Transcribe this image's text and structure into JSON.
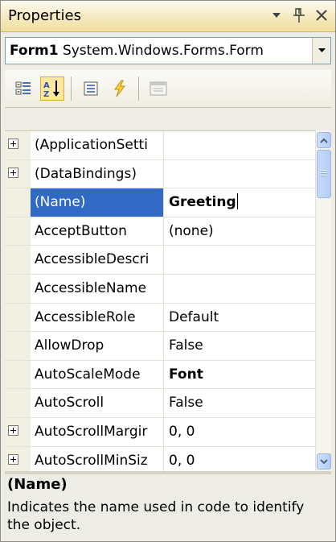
{
  "window": {
    "title": "Properties"
  },
  "object_selector": {
    "name": "Form1",
    "type": "System.Windows.Forms.Form"
  },
  "toolbar": {
    "buttons": [
      {
        "icon": "categorized-icon"
      },
      {
        "icon": "alphabetical-icon",
        "pressed": true
      },
      {
        "icon": "properties-icon"
      },
      {
        "icon": "events-icon"
      },
      {
        "icon": "property-pages-icon",
        "disabled": true
      }
    ]
  },
  "grid": {
    "rows": [
      {
        "name": "(ApplicationSetti",
        "value": "",
        "expandable": true
      },
      {
        "name": "(DataBindings)",
        "value": "",
        "expandable": true
      },
      {
        "name": "(Name)",
        "value": "Greeting",
        "selected": true,
        "bold": true
      },
      {
        "name": "AcceptButton",
        "value": "(none)"
      },
      {
        "name": "AccessibleDescri",
        "value": ""
      },
      {
        "name": "AccessibleName",
        "value": ""
      },
      {
        "name": "AccessibleRole",
        "value": "Default"
      },
      {
        "name": "AllowDrop",
        "value": "False"
      },
      {
        "name": "AutoScaleMode",
        "value": "Font",
        "bold": true
      },
      {
        "name": "AutoScroll",
        "value": "False"
      },
      {
        "name": "AutoScrollMargir",
        "value": "0, 0",
        "expandable": true
      },
      {
        "name": "AutoScrollMinSiz",
        "value": "0, 0",
        "expandable": true
      }
    ]
  },
  "description": {
    "title": "(Name)",
    "text": "Indicates the name used in code to identify the object."
  },
  "colors": {
    "selection": "#316ac5",
    "title_gradient_end": "#f1df9f"
  }
}
